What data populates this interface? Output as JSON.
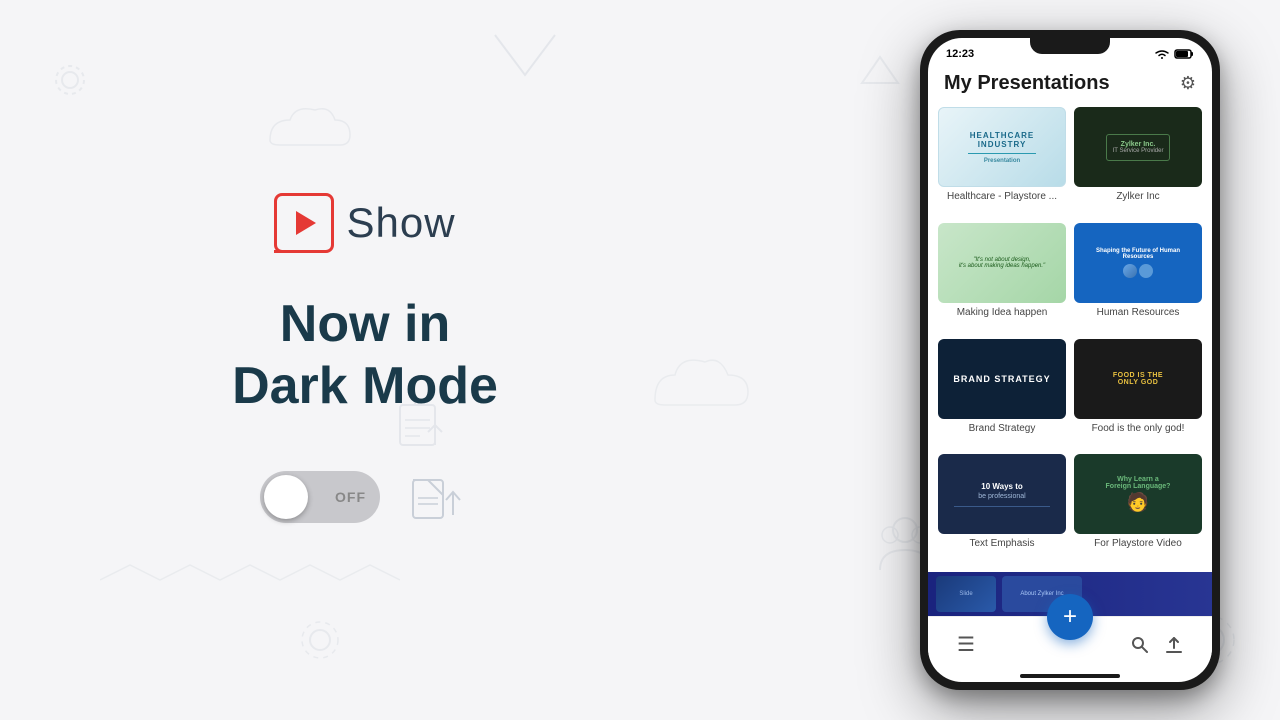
{
  "app": {
    "name": "Show",
    "tagline_line1": "Now in",
    "tagline_line2": "Dark Mode",
    "toggle_state": "OFF",
    "background_color": "#f5f5f7"
  },
  "status_bar": {
    "time": "12:23",
    "battery_icon": "🔋",
    "wifi_icon": "📶"
  },
  "phone": {
    "header": {
      "title": "My Presentations",
      "settings_icon": "⚙"
    },
    "presentations": [
      {
        "id": 1,
        "label": "Healthcare - Playstore ...",
        "thumb_type": "healthcare"
      },
      {
        "id": 2,
        "label": "Zylker Inc",
        "thumb_type": "zylker"
      },
      {
        "id": 3,
        "label": "Making Idea happen",
        "thumb_type": "making"
      },
      {
        "id": 4,
        "label": "Human Resources",
        "thumb_type": "hr"
      },
      {
        "id": 5,
        "label": "Brand Strategy",
        "thumb_type": "brand"
      },
      {
        "id": 6,
        "label": "Food is the only god!",
        "thumb_type": "food"
      },
      {
        "id": 7,
        "label": "Text Emphasis",
        "thumb_type": "text_emphasis"
      },
      {
        "id": 8,
        "label": "For Playstore Video",
        "thumb_type": "playstore"
      }
    ],
    "fab_label": "+",
    "nav_icons": {
      "menu": "☰",
      "search": "🔍",
      "upload": "⬆"
    }
  }
}
